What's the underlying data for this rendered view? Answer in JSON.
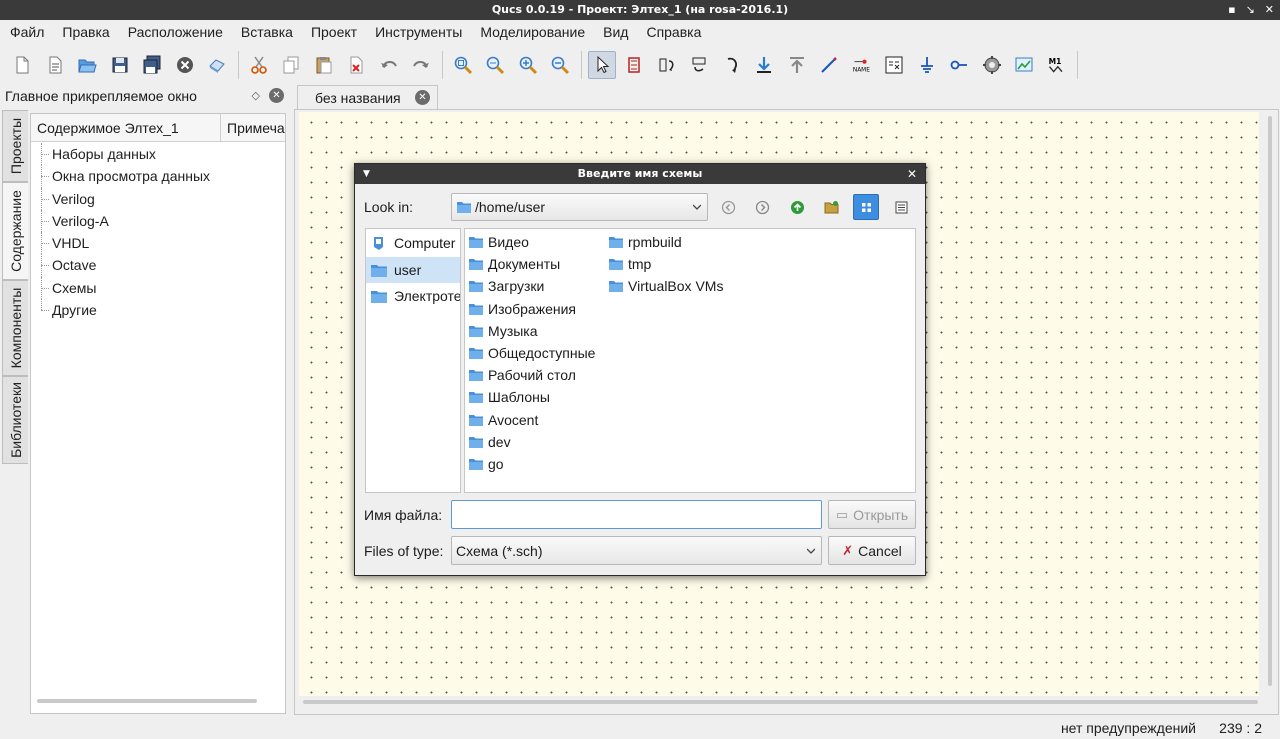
{
  "window": {
    "title": "Qucs 0.0.19 - Проект: Элтех_1 (на rosa-2016.1)",
    "controls": [
      "▪",
      "↘",
      "✕"
    ]
  },
  "menubar": [
    "Файл",
    "Правка",
    "Расположение",
    "Вставка",
    "Проект",
    "Инструменты",
    "Моделирование",
    "Вид",
    "Справка"
  ],
  "toolbar": {
    "groups": [
      [
        "new-file-icon",
        "new-text-icon",
        "open-icon",
        "save-icon",
        "save-all-icon",
        "close-icon",
        "print-icon"
      ],
      [
        "cut-icon",
        "copy-icon",
        "paste-icon",
        "delete-icon",
        "undo-icon",
        "redo-icon"
      ],
      [
        "zoom-fit-icon",
        "zoom-select-icon",
        "zoom-in-icon",
        "zoom-out-icon"
      ],
      [
        "select-icon",
        "component-icon",
        "mirror-x-icon",
        "mirror-y-icon",
        "rotate-icon",
        "go-into-icon",
        "go-up-icon",
        "wire-icon",
        "label-icon",
        "equation-icon",
        "ground-icon",
        "port-icon",
        "simulate-icon",
        "display-icon",
        "marker-icon"
      ]
    ],
    "label_icon_text": "NAME",
    "marker_text": "M1"
  },
  "dock": {
    "title": "Главное прикрепляемое окно",
    "tabs": [
      "Проекты",
      "Содержание",
      "Компоненты",
      "Библиотеки"
    ],
    "active_tab": "Содержание",
    "tree": {
      "columns": [
        "Содержимое Элтех_1",
        "Примечания"
      ],
      "items": [
        "Наборы данных",
        "Окна просмотра данных",
        "Verilog",
        "Verilog-A",
        "VHDL",
        "Octave",
        "Схемы",
        "Другие"
      ]
    }
  },
  "document": {
    "tab_label": "без названия"
  },
  "statusbar": {
    "warnings": "нет предупреждений",
    "position": "239 : 2"
  },
  "dialog": {
    "title": "Введите имя схемы",
    "look_in_label": "Look in:",
    "look_in_value": "/home/user",
    "sidebar": [
      {
        "label": "Computer",
        "icon": "computer-icon"
      },
      {
        "label": "user",
        "icon": "folder-icon",
        "selected": true
      },
      {
        "label": "Электротехника",
        "icon": "folder-icon"
      }
    ],
    "files_col1": [
      "Видео",
      "Документы",
      "Загрузки",
      "Изображения",
      "Музыка",
      "Общедоступные",
      "Рабочий стол",
      "Шаблоны",
      "Avocent",
      "dev",
      "go"
    ],
    "files_col2": [
      "rpmbuild",
      "tmp",
      "VirtualBox VMs"
    ],
    "filename_label": "Имя файла:",
    "filename_value": "",
    "open_button": "Открыть",
    "filetype_label": "Files of type:",
    "filetype_value": "Схема (*.sch)",
    "cancel_button": "Cancel"
  },
  "colors": {
    "canvas_bg": "#fefbe9",
    "titlebar_bg": "#3a3a3a",
    "selected_view_btn": "#3d8ee0",
    "folder_blue": "#4a90d9"
  }
}
